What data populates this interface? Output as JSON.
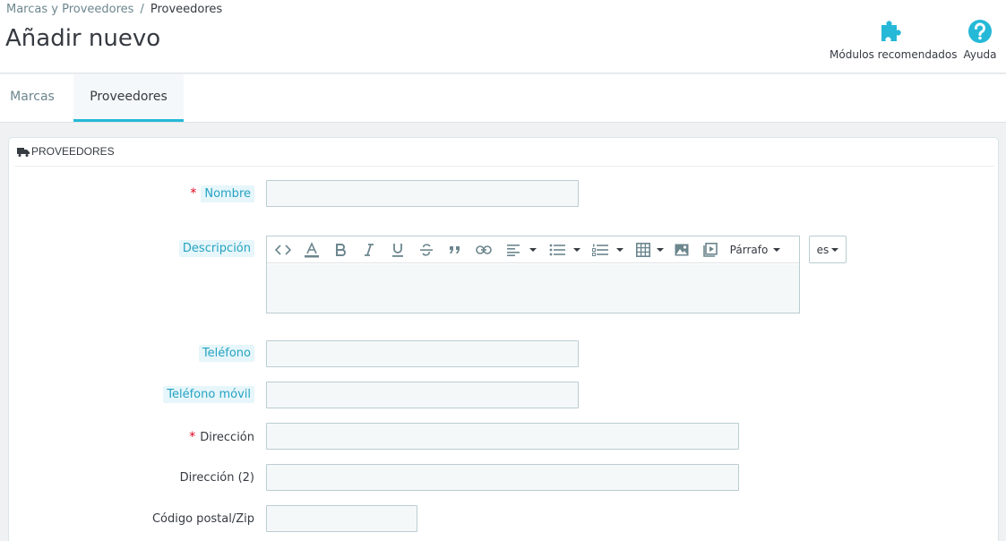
{
  "breadcrumb": {
    "parent": "Marcas y Proveedores",
    "separator": "/",
    "current": "Proveedores"
  },
  "page": {
    "title": "Añadir nuevo"
  },
  "toolbar": {
    "modules_label": "Módulos recomendados",
    "modules_icon": "puzzle-icon",
    "help_label": "Ayuda",
    "help_icon": "question-circle-icon",
    "accent_color": "#25b9d7"
  },
  "tabs": [
    {
      "label": "Marcas",
      "active": false
    },
    {
      "label": "Proveedores",
      "active": true
    }
  ],
  "panel": {
    "title": "PROVEEDORES",
    "icon": "truck-icon"
  },
  "form": {
    "required_mark": "*",
    "nombre": {
      "label": "Nombre",
      "value": "",
      "required": true
    },
    "descripcion": {
      "label": "Descripción",
      "value": "",
      "paragraph_label": "Párrafo",
      "language": "es"
    },
    "telefono": {
      "label": "Teléfono",
      "value": ""
    },
    "telefono_movil": {
      "label": "Teléfono móvil",
      "value": ""
    },
    "direccion": {
      "label": "Dirección",
      "value": "",
      "required": true
    },
    "direccion2": {
      "label": "Dirección (2)",
      "value": ""
    },
    "codigo_postal": {
      "label": "Código postal/Zip",
      "value": ""
    }
  }
}
